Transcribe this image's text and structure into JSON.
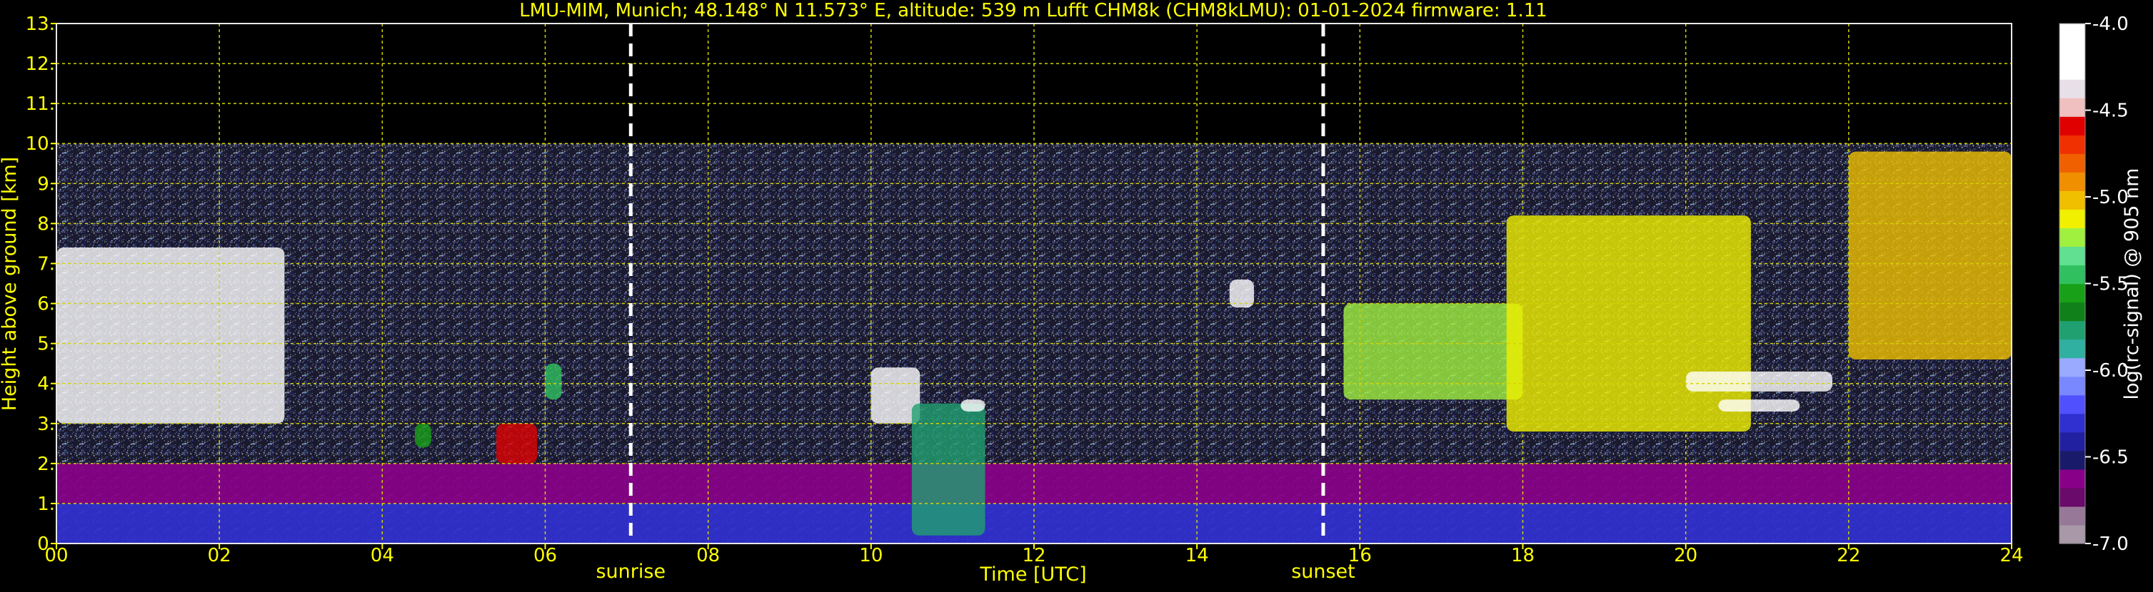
{
  "chart_data": {
    "type": "heatmap",
    "title": "LMU-MIM, Munich; 48.148° N 11.573° E, altitude: 539 m    Lufft CHM8k (CHM8kLMU): 01-01-2024    firmware: 1.11",
    "xlabel": "Time [UTC]",
    "ylabel": "Height above ground [km]",
    "xlim": [
      0,
      24
    ],
    "ylim": [
      0,
      13
    ],
    "x_ticks": [
      0,
      2,
      4,
      6,
      8,
      10,
      12,
      14,
      16,
      18,
      20,
      22,
      24
    ],
    "x_tick_labels": [
      "00",
      "02",
      "04",
      "06",
      "08",
      "10",
      "12",
      "14",
      "16",
      "18",
      "20",
      "22",
      "24"
    ],
    "y_ticks": [
      0,
      1,
      2,
      3,
      4,
      5,
      6,
      7,
      8,
      9,
      10,
      11,
      12,
      13
    ],
    "y_tick_labels": [
      "0.",
      "1.",
      "2.",
      "3.",
      "4.",
      "5.",
      "6.",
      "7.",
      "8.",
      "9.",
      "10.",
      "11.",
      "12.",
      "13."
    ],
    "grid": true,
    "measurement_top_km": 10,
    "events": [
      {
        "label": "sunrise",
        "time": 7.05
      },
      {
        "label": "sunset",
        "time": 15.55
      }
    ],
    "colorbar": {
      "label": "log(rc-signal) @ 905 nm",
      "min": -7.0,
      "max": -4.0,
      "ticks": [
        -7.0,
        -6.5,
        -6.0,
        -5.5,
        -5.0,
        -4.5,
        -4.0
      ],
      "tick_labels": [
        "-7.0",
        "-6.5",
        "-6.0",
        "-5.5",
        "-5.0",
        "-4.5",
        "-4.0"
      ],
      "colors": [
        "#a898a8",
        "#987898",
        "#6a0a6a",
        "#880088",
        "#1a1a6a",
        "#2020a0",
        "#3030d0",
        "#5050ff",
        "#7a88ff",
        "#9aaaff",
        "#30b0a0",
        "#20a070",
        "#10801a",
        "#18a018",
        "#30c060",
        "#60e090",
        "#a0f040",
        "#f0f000",
        "#f0c000",
        "#f09000",
        "#f06000",
        "#f03000",
        "#e00000",
        "#f0c0c0",
        "#e8e0e8",
        "#ffffff",
        "#ffffff",
        "#ffffff"
      ]
    },
    "layers": [
      {
        "name": "boundary layer aerosol",
        "time_start": 0,
        "time_end": 24,
        "height_km": [
          0,
          1.0
        ],
        "level": -6.3
      },
      {
        "name": "elevated aerosol",
        "time_start": 0,
        "time_end": 24,
        "height_km": [
          1.0,
          2.0
        ],
        "level": -6.6
      },
      {
        "name": "cloud",
        "time_start": 0.0,
        "time_end": 2.8,
        "height_km": [
          3.0,
          7.4
        ],
        "level": -4.2
      },
      {
        "name": "cloud",
        "time_start": 4.4,
        "time_end": 4.6,
        "height_km": [
          2.4,
          3.0
        ],
        "level": -5.6
      },
      {
        "name": "cloud",
        "time_start": 5.4,
        "time_end": 5.9,
        "height_km": [
          2.0,
          3.0
        ],
        "level": -4.6
      },
      {
        "name": "cloud",
        "time_start": 6.0,
        "time_end": 6.2,
        "height_km": [
          3.6,
          4.5
        ],
        "level": -5.4
      },
      {
        "name": "cloud",
        "time_start": 10.0,
        "time_end": 10.6,
        "height_km": [
          3.0,
          4.4
        ],
        "level": -4.3
      },
      {
        "name": "cloud",
        "time_start": 10.5,
        "time_end": 11.4,
        "height_km": [
          0.2,
          3.5
        ],
        "level": -5.8
      },
      {
        "name": "cloud",
        "time_start": 11.1,
        "time_end": 11.4,
        "height_km": [
          3.3,
          3.6
        ],
        "level": -4.3
      },
      {
        "name": "cloud",
        "time_start": 14.4,
        "time_end": 14.7,
        "height_km": [
          5.9,
          6.6
        ],
        "level": -4.2
      },
      {
        "name": "cloud",
        "time_start": 15.8,
        "time_end": 18.0,
        "height_km": [
          3.6,
          6.0
        ],
        "level": -5.2
      },
      {
        "name": "cloud",
        "time_start": 17.8,
        "time_end": 20.8,
        "height_km": [
          2.8,
          8.2
        ],
        "level": -5.1
      },
      {
        "name": "cloud",
        "time_start": 20.0,
        "time_end": 21.8,
        "height_km": [
          3.8,
          4.3
        ],
        "level": -4.2
      },
      {
        "name": "cloud",
        "time_start": 20.4,
        "time_end": 21.4,
        "height_km": [
          3.3,
          3.6
        ],
        "level": -4.2
      },
      {
        "name": "cloud",
        "time_start": 22.0,
        "time_end": 24.0,
        "height_km": [
          4.6,
          9.8
        ],
        "level": -5.0
      }
    ]
  }
}
